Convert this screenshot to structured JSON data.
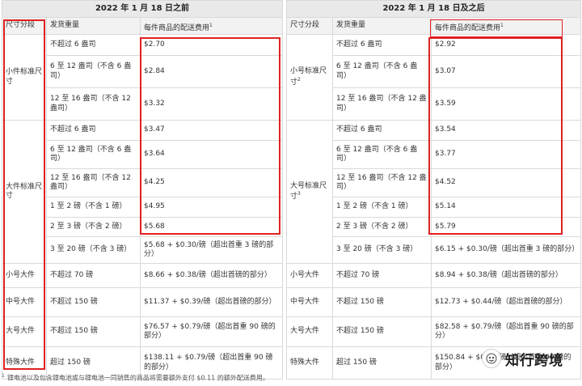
{
  "left": {
    "title": "2022 年 1 月 18 日之前",
    "headers": {
      "tier": "尺寸分段",
      "weight": "发货重量",
      "fee": "每件商品的配送费用",
      "fee_sup": "1"
    },
    "groups": [
      {
        "name": "小件标准尺寸",
        "sup": "",
        "rows": [
          {
            "weight": "不超过 6 盎司",
            "fee": "$2.70"
          },
          {
            "weight": "6 至 12 盎司（不含 6 盎司）",
            "fee": "$2.84"
          },
          {
            "weight": "12 至 16 盎司（不含 12 盎司）",
            "fee": "$3.32"
          }
        ]
      },
      {
        "name": "大件标准尺寸",
        "sup": "",
        "rows": [
          {
            "weight": "不超过 6 盎司",
            "fee": "$3.47"
          },
          {
            "weight": "6 至 12 盎司（不含 6 盎司）",
            "fee": "$3.64"
          },
          {
            "weight": "12 至 16 盎司（不含 12 盎司）",
            "fee": "$4.25"
          },
          {
            "weight": "1 至 2 磅（不含 1 磅）",
            "fee": "$4.95"
          },
          {
            "weight": "2 至 3 磅（不含 2 磅）",
            "fee": "$5.68"
          },
          {
            "weight": "3 至 20 磅（不含 3 磅）",
            "fee": "$5.68 + $0.30/磅（超出首重 3 磅的部分）"
          }
        ]
      },
      {
        "name": "小号大件",
        "sup": "",
        "rows": [
          {
            "weight": "不超过 70 磅",
            "fee": "$8.66 + $0.38/磅（超出首磅的部分）"
          }
        ]
      },
      {
        "name": "中号大件",
        "sup": "",
        "rows": [
          {
            "weight": "不超过 150 磅",
            "fee": "$11.37 + $0.39/磅（超出首磅的部分）"
          }
        ]
      },
      {
        "name": "大号大件",
        "sup": "",
        "rows": [
          {
            "weight": "不超过 150 磅",
            "fee": "$76.57 + $0.79/磅（超出首重 90 磅的部分）"
          }
        ]
      },
      {
        "name": "特殊大件",
        "sup": "",
        "rows": [
          {
            "weight": "超过 150 磅",
            "fee": "$138.11 + $0.79/磅（超出首重 90 磅的部分）"
          }
        ]
      }
    ]
  },
  "right": {
    "title": "2022 年 1 月 18 日及之后",
    "headers": {
      "tier": "尺寸分段",
      "weight": "发货重量",
      "fee": "每件商品的配送费用",
      "fee_sup": "1"
    },
    "groups": [
      {
        "name": "小号标准尺寸",
        "sup": "2",
        "rows": [
          {
            "weight": "不超过 6 盎司",
            "fee": "$2.92"
          },
          {
            "weight": "6 至 12 盎司（不含 6 盎司）",
            "fee": "$3.07"
          },
          {
            "weight": "12 至 16 盎司（不含 12 盎司）",
            "fee": "$3.59"
          }
        ]
      },
      {
        "name": "大号标准尺寸",
        "sup": "3",
        "rows": [
          {
            "weight": "不超过 6 盎司",
            "fee": "$3.54"
          },
          {
            "weight": "6 至 12 盎司（不含 6 盎司）",
            "fee": "$3.77"
          },
          {
            "weight": "12 至 16 盎司（不含 12 盎司）",
            "fee": "$4.52"
          },
          {
            "weight": "1 至 2 磅（不含 1 磅）",
            "fee": "$5.14"
          },
          {
            "weight": "2 至 3 磅（不含 2 磅）",
            "fee": "$5.79"
          },
          {
            "weight": "3 至 20 磅（不含 3 磅）",
            "fee": "$6.15 + $0.30/磅（超出首重 3 磅的部分）"
          }
        ]
      },
      {
        "name": "小号大件",
        "sup": "",
        "rows": [
          {
            "weight": "不超过 70 磅",
            "fee": "$8.94 + $0.38/磅（超出首磅的部分）"
          }
        ]
      },
      {
        "name": "中号大件",
        "sup": "",
        "rows": [
          {
            "weight": "不超过 150 磅",
            "fee": "$12.73 + $0.44/磅（超出首磅的部分）"
          }
        ]
      },
      {
        "name": "大号大件",
        "sup": "",
        "rows": [
          {
            "weight": "不超过 150 磅",
            "fee": "$82.58 + $0.79/磅（超出首重 90 磅的部分）"
          }
        ]
      },
      {
        "name": "特殊大件",
        "sup": "",
        "rows": [
          {
            "weight": "超过 150 磅",
            "fee": "$150.84 + $0.79/磅（超出首重 90 磅的部分）"
          }
        ]
      }
    ]
  },
  "footnote": {
    "mark": "1",
    "text": "锂电池以及包含锂电池或与锂电池一同销售的商品将需要额外支付 $0.11 的额外配送费用。"
  },
  "watermark": {
    "icon": "mascot-icon",
    "text": "知行跨境"
  },
  "colors": {
    "highlight_border": "#e02020",
    "header_bg": "#e9e9e9",
    "grid": "#d9d9d9"
  }
}
